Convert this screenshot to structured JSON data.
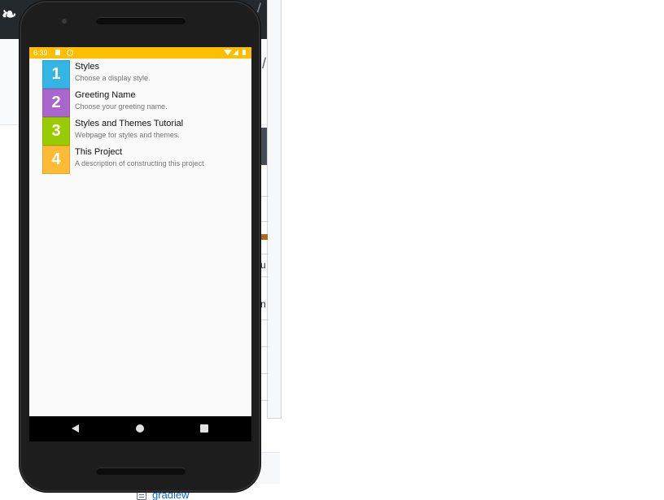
{
  "background_page": {
    "file_link": "gradlew",
    "cell_texts": [
      "u",
      "n"
    ]
  },
  "status_bar": {
    "time": "6:39",
    "color": "#ffbf00"
  },
  "list": [
    {
      "number": "1",
      "title": "Styles",
      "subtitle": "Choose a display style.",
      "color": "#33b5e5"
    },
    {
      "number": "2",
      "title": "Greeting Name",
      "subtitle": "Choose your greeting name.",
      "color": "#aa66cc"
    },
    {
      "number": "3",
      "title": "Styles and Themes Tutorial",
      "subtitle": "Webpage for styles and themes.",
      "color": "#99cc00"
    },
    {
      "number": "4",
      "title": "This Project",
      "subtitle": "A description of constructing this project",
      "color": "#ffbb33"
    }
  ],
  "icons": {
    "status": [
      "sd-card-icon",
      "sync-icon",
      "wifi-icon",
      "signal-icon",
      "battery-icon"
    ],
    "nav": [
      "back-icon",
      "home-icon",
      "recents-icon"
    ]
  }
}
